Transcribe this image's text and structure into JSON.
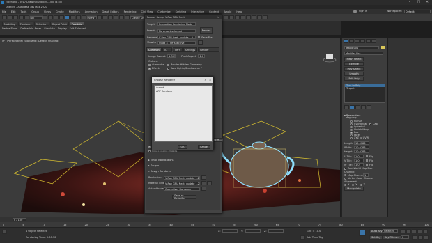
{
  "title_bar": {
    "title": "Untitled - Autodesk 3ds Max 2020",
    "tabs_text": "[Scenarjo - 2017\\Drawing\\Untitled-1.jpg (4:5)]"
  },
  "menu": [
    "File",
    "Edit",
    "Tools",
    "Group",
    "Views",
    "Create",
    "Modifiers",
    "Animation",
    "Graph Editors",
    "Rendering",
    "Civil View",
    "Customize",
    "Scripting",
    "Interactive",
    "Content",
    "Arnold",
    "Help"
  ],
  "signin": "Sign In",
  "workspaces_label": "Workspaces:",
  "workspaces_value": "Default",
  "toolbar2": {
    "left_tabs": [
      "Modeling",
      "Freeform",
      "Selection",
      "Object Paint",
      "Populate"
    ],
    "sub": [
      "Define Flows",
      "Define Idle Areas",
      "Simulate",
      "Display",
      "Edit Selected"
    ],
    "view_dropdown": "View",
    "create_selection": "Create Selection Se"
  },
  "viewport_label": "[+] [Perspective] [Standard] [Default Shading]",
  "render_setup": {
    "title": "Render Setup: V-Ray GPU Next",
    "target_label": "Target:",
    "target_value": "Production Rendering Mode",
    "preset_label": "Preset:",
    "preset_value": "No preset selected",
    "renderer_label": "Renderer:",
    "renderer_value": "V-Ray GPU Next, update 1.2",
    "save_file": "Save File",
    "render_button": "Render",
    "view_label": "View to Render:",
    "view_value": "Quad 4 - Perspective",
    "tabs": [
      "Common",
      "V-Ray",
      "Perf.",
      "Settings",
      "Render Elements"
    ],
    "image_aspect_label": "Image Aspect:",
    "image_aspect_value": "1.333",
    "pixel_aspect_label": "Pixel Aspect:",
    "pixel_aspect_value": "1.0",
    "options_label": "Options",
    "opt_atmospherics": "Atmospherics",
    "opt_render_hidden": "Render Hidden Geometry",
    "opt_effects": "Effects",
    "opt_area_lights": "Area Lights/Shadows as Points",
    "standard_frame": "Standard Frame Window",
    "skip_existing": "Skip Existing Images",
    "email_notifications": "Email Notifications",
    "scripts": "Scripts",
    "assign_renderer": "Assign Renderer",
    "production_label": "Production:",
    "production_value": "V-Ray GPU Next, update 1.2",
    "material_editor_label": "Material Editor:",
    "material_editor_value": "V-Ray GPU Next, update 1.2",
    "activeshade_label": "ActiveShade:",
    "activeshade_value": "Quicksilver Hardware",
    "save_defaults": "Save as Defaults",
    "devices_button": "Devices..."
  },
  "choose_renderer": {
    "title": "Choose Renderer",
    "items": [
      "Arnold",
      "ART Renderer"
    ],
    "ok": "OK",
    "cancel": "Cancel"
  },
  "right_panel": {
    "object_name": "Teapot001",
    "modifier_list": "Modifier List",
    "buttons": [
      "Mesh Select",
      "Extrude",
      "Poly Select",
      "Smooth",
      "Edit Poly"
    ],
    "stack": [
      "Turn to Poly",
      "Teapot"
    ],
    "parameters": "Parameters",
    "mapping_label": "Mapping:",
    "mapping_options": [
      "Planar",
      "Cylindrical",
      "Cap",
      "Spherical",
      "Shrink Wrap",
      "Box",
      "Face",
      "XYZ to UVW"
    ],
    "length_label": "Length:",
    "length_value": "10.0786",
    "width_label": "Width:",
    "width_value": "10.0786",
    "height_label": "Height:",
    "height_value": "10.0786",
    "utile_label": "U Tile:",
    "utile_value": "1.0",
    "vtile_label": "V Tile:",
    "vtile_value": "1.0",
    "wtile_label": "W Tile:",
    "wtile_value": "1.0",
    "flip": "Flip",
    "real_world": "Real-World Map Size",
    "channel_label": "Channel:",
    "map_channel": "Map Channel:",
    "map_channel_value": "1",
    "vertex_color": "Vertex Color Channel",
    "alignment_label": "Alignment:",
    "xyz": [
      "X",
      "Y",
      "Z"
    ],
    "manipulate": "Manipulate"
  },
  "timeline": {
    "frame": "0 / 100",
    "ticks": [
      "0",
      "5",
      "10",
      "15",
      "20",
      "25",
      "30",
      "35",
      "40",
      "45",
      "50",
      "55",
      "60",
      "65",
      "70",
      "75",
      "80",
      "85",
      "90",
      "95",
      "100"
    ]
  },
  "status": {
    "selected": "1 Object Selected",
    "rendering_time": "Rendering Time: 0:00:10",
    "x_label": "X:",
    "y_label": "Y:",
    "z_label": "Z:",
    "grid": "Grid = 10.0",
    "add_time_tag": "Add Time Tag",
    "auto_key": "Auto Key",
    "selected_btn": "Selected",
    "set_key": "Set Key",
    "key_filters": "Key Filters...",
    "frame_value": "0"
  },
  "colors": {
    "accent": "#3a74a8",
    "object_swatch": "#d9c75a"
  }
}
